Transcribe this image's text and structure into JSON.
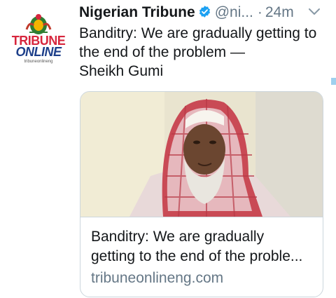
{
  "author": {
    "name": "Nigerian Tribune",
    "handle": "@ni...",
    "separator": "·",
    "time": "24m",
    "avatar_text": {
      "line1": "TRIBUNE",
      "line2": "ONLINE",
      "line3": "tribuneonlineng"
    },
    "verified_icon": "verified-badge-icon",
    "menu_icon": "chevron-down-icon"
  },
  "tweet": {
    "lines": [
      "Banditry: We are gradually getting to",
      "the end of the problem —",
      "Sheikh Gumi"
    ]
  },
  "card": {
    "title_lines": [
      "Banditry: We are gradually",
      "getting to the end of the proble..."
    ],
    "domain": "tribuneonlineng.com"
  },
  "colors": {
    "text": "#14171a",
    "secondary": "#657786",
    "verified": "#1da1f2",
    "border": "#ccd6dd"
  }
}
